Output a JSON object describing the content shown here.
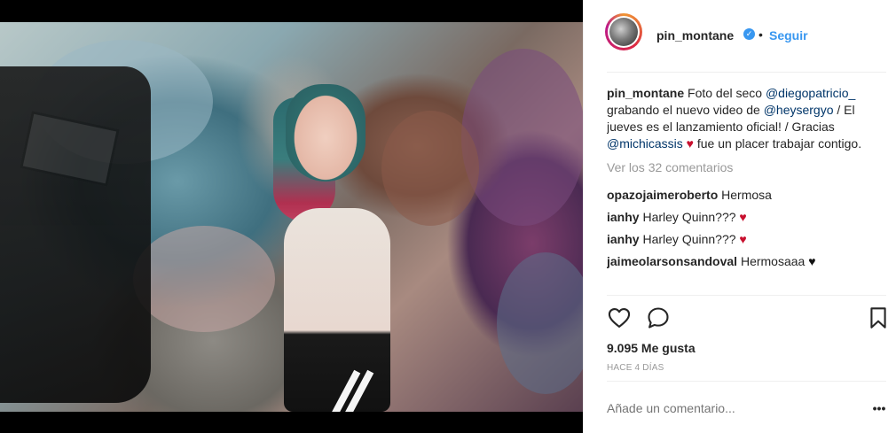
{
  "post": {
    "author": {
      "username": "pin_montane",
      "follow_label": "Seguir",
      "separator": "•"
    },
    "caption": {
      "username": "pin_montane",
      "text_1": " Foto del seco ",
      "mention_1": "@diegopatricio_",
      "text_2": " grabando el nuevo video de ",
      "mention_2": "@heysergyo",
      "text_3": " / El jueves es el lanzamiento oficial! / Gracias ",
      "mention_3": "@michicassis",
      "text_4": " fue un placer trabajar contigo."
    },
    "view_all_comments": "Ver los 32 comentarios",
    "comments": [
      {
        "username": "opazojaimeroberto",
        "text": "Hermosa",
        "heart": ""
      },
      {
        "username": "ianhy",
        "text": "Harley Quinn???",
        "heart": "♥"
      },
      {
        "username": "ianhy",
        "text": "Harley Quinn???",
        "heart": "♥"
      },
      {
        "username": "jaimeolarsonsandoval",
        "text": "Hermosaaa",
        "heart": "♥"
      }
    ],
    "likes": "9.095 Me gusta",
    "timestamp": "HACE 4 DÍAS",
    "comment_input_placeholder": "Añade un comentario...",
    "more_label": "•••"
  },
  "icons": {
    "verified": "verified-badge-icon",
    "like": "heart-outline-icon",
    "comment": "speech-bubble-icon",
    "save": "bookmark-icon",
    "heart_color": "#c8102e",
    "accent": "#3897f0"
  }
}
